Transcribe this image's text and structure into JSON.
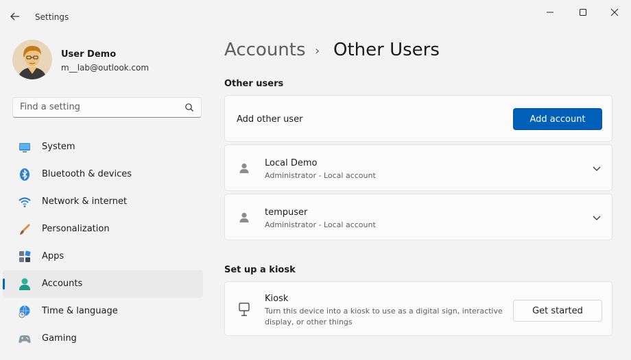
{
  "window": {
    "title": "Settings",
    "controls": [
      "minimize-icon",
      "maximize-icon",
      "close-icon"
    ]
  },
  "profile": {
    "name": "User Demo",
    "email": "m__lab@outlook.com"
  },
  "search": {
    "placeholder": "Find a setting"
  },
  "sidebar": {
    "items": [
      {
        "label": "System",
        "icon": "monitor-icon"
      },
      {
        "label": "Bluetooth & devices",
        "icon": "bluetooth-icon"
      },
      {
        "label": "Network & internet",
        "icon": "wifi-icon"
      },
      {
        "label": "Personalization",
        "icon": "brush-icon"
      },
      {
        "label": "Apps",
        "icon": "apps-icon"
      },
      {
        "label": "Accounts",
        "icon": "person-icon",
        "active": true
      },
      {
        "label": "Time & language",
        "icon": "globe-clock-icon"
      },
      {
        "label": "Gaming",
        "icon": "gamepad-icon"
      }
    ]
  },
  "breadcrumb": {
    "parent": "Accounts",
    "separator": "›",
    "current": "Other Users"
  },
  "other_users": {
    "title": "Other users",
    "add_label": "Add other user",
    "add_button": "Add account",
    "users": [
      {
        "name": "Local Demo",
        "detail": "Administrator - Local account"
      },
      {
        "name": "tempuser",
        "detail": "Administrator - Local account"
      }
    ]
  },
  "kiosk": {
    "title": "Set up a kiosk",
    "label": "Kiosk",
    "description_line1": "Turn this device into a kiosk to use as a digital sign, interactive",
    "description_line2": "display, or other things",
    "button": "Get started"
  },
  "colors": {
    "accent": "#005fb8",
    "background": "#f3f3f3",
    "card": "#fbfbfb"
  }
}
